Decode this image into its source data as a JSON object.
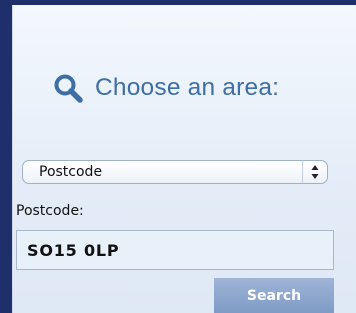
{
  "panel": {
    "heading": "Choose an area:",
    "heading_icon": "search-icon",
    "accent_color": "#3d6ea5"
  },
  "area_select": {
    "selected": "Postcode",
    "icon": "updown-arrows-icon"
  },
  "postcode_field": {
    "label": "Postcode:",
    "value": "SO15 0LP"
  },
  "search_button": {
    "label": "Search",
    "color": "#8ea8cf"
  }
}
